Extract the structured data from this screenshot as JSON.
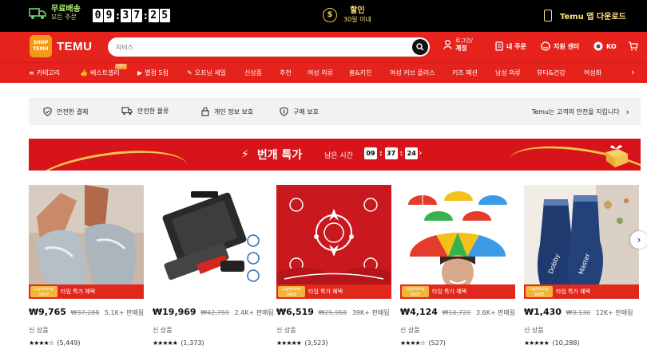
{
  "topbar": {
    "shipping_title": "무료배송",
    "shipping_sub": "모든 주문",
    "countdown": [
      "0",
      "9",
      "3",
      "7",
      "2",
      "5"
    ],
    "sale_title": "할인",
    "sale_sub": "30일 이내",
    "app_download": "Temu 앱 다운로드"
  },
  "header": {
    "logo_text": "TEMU",
    "brand": "TEMU",
    "search_placeholder": "지비스",
    "login_line1": "로그인/",
    "login_line2": "계정",
    "orders": "내 주문",
    "support": "지원 센터",
    "language": "KO"
  },
  "categories": [
    {
      "icon": "≡",
      "label": "카테고리"
    },
    {
      "icon": "👍",
      "label": "베스트셀러"
    },
    {
      "icon": "▶",
      "label": "별점 5점"
    },
    {
      "icon": "✎",
      "label": "오프닝 세일"
    },
    {
      "icon": "",
      "label": "신상품"
    },
    {
      "icon": "",
      "label": "추천"
    },
    {
      "icon": "",
      "label": "여성 의류"
    },
    {
      "icon": "",
      "label": "홈&키친"
    },
    {
      "icon": "",
      "label": "여성 커브 플러스"
    },
    {
      "icon": "",
      "label": "키즈 패션"
    },
    {
      "icon": "",
      "label": "남성 의류"
    },
    {
      "icon": "",
      "label": "뷰티&건강"
    },
    {
      "icon": "",
      "label": "여성화"
    }
  ],
  "hot_badge": "HOT",
  "safety": {
    "items": [
      "안전한 결제",
      "안전한 물류",
      "개인 정보 보호",
      "구매 보호"
    ],
    "right": "Temu는 고객의 안전을 지킵니다"
  },
  "deal": {
    "title": "번개 특가",
    "left_label": "남은 시간",
    "hh": "09",
    "mm": "37",
    "ss": "24"
  },
  "products": [
    {
      "badge_tag": "Lightning SALE",
      "badge": "타임 특가 혜택",
      "price": "₩9,765",
      "old": "₩37,288",
      "sold": "5.1K+ 판매됨",
      "cond": "신 상품",
      "stars": "★★★★☆",
      "count": "(5,449)"
    },
    {
      "badge_tag": "",
      "badge": "",
      "price": "₩19,969",
      "old": "₩42,759",
      "sold": "2.4K+ 판매됨",
      "cond": "신 상품",
      "stars": "★★★★★",
      "count": "(1,373)"
    },
    {
      "badge_tag": "Lightning SALE",
      "badge": "타임 특가 혜택",
      "price": "₩6,519",
      "old": "₩25,958",
      "sold": "39K+ 판매됨",
      "cond": "신 상품",
      "stars": "★★★★★",
      "count": "(3,523)"
    },
    {
      "badge_tag": "Lightning SALE",
      "badge": "타임 특가 혜택",
      "price": "₩4,124",
      "old": "₩10,729",
      "sold": "3.6K+ 판매됨",
      "cond": "신 상품",
      "stars": "★★★★☆",
      "count": "(527)"
    },
    {
      "badge_tag": "Lightning SALE",
      "badge": "타임 특가 혜택",
      "price": "₩1,430",
      "old": "₩3,130",
      "sold": "12K+ 판매됨",
      "cond": "신 상품",
      "stars": "★★★★★",
      "count": "(10,288)"
    }
  ],
  "colors": {
    "brand_red": "#e5231c",
    "deal_red": "#d7141a",
    "logo_orange": "#f39b18"
  }
}
